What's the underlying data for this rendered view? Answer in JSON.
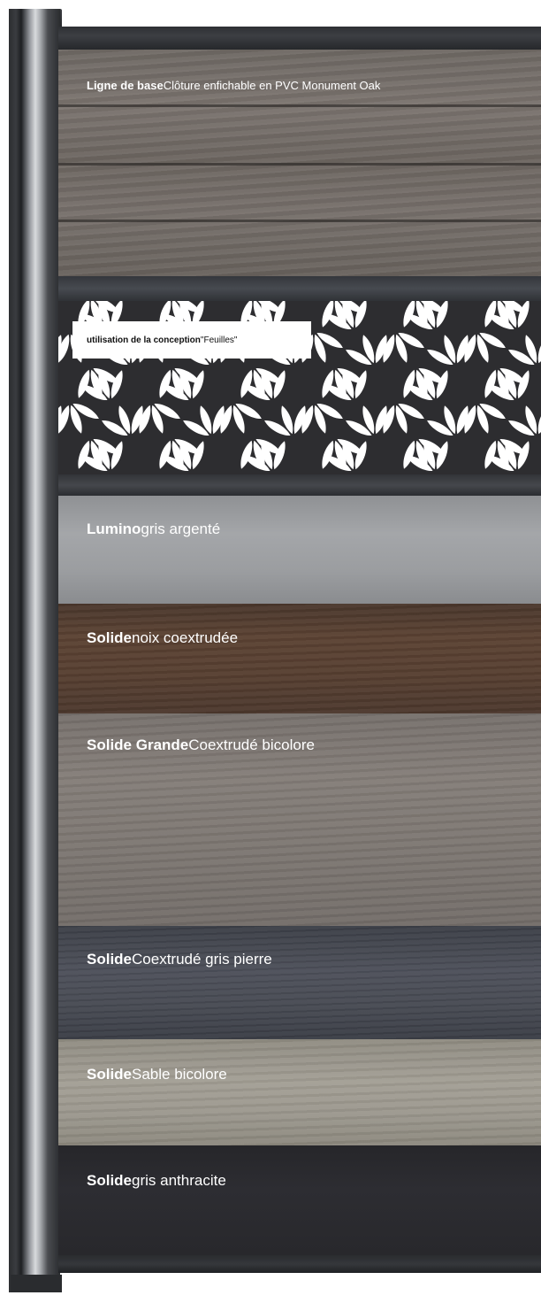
{
  "panels": [
    {
      "id": "oak",
      "bold": "Ligne de base",
      "text": "Clôture enfichable en PVC Monument Oak"
    },
    {
      "id": "lumino",
      "bold": "Lumino",
      "text": "gris argenté"
    },
    {
      "id": "walnut",
      "bold": "Solide",
      "text": "noix coextrudée"
    },
    {
      "id": "grande",
      "bold": "Solide Grande",
      "text": "Coextrudé bicolore"
    },
    {
      "id": "stone",
      "bold": "Solide",
      "text": "Coextrudé gris pierre"
    },
    {
      "id": "sand",
      "bold": "Solide",
      "text": "Sable bicolore"
    },
    {
      "id": "anthracite",
      "bold": "Solide",
      "text": "gris anthracite"
    }
  ],
  "design": {
    "bold": "utilisation de la conception",
    "text": "\"Feuilles\""
  },
  "colors": {
    "post": "#9a9da2",
    "rail": "#3c3e43",
    "oak": "#726b66",
    "leaf_background": "#2d2d30",
    "leaf": "#ffffff",
    "lumino": "#9b9da0",
    "walnut": "#573f31",
    "grande": "#7d7772",
    "stone": "#474a53",
    "sand": "#9a968c",
    "anthracite": "#2a2a2e"
  }
}
